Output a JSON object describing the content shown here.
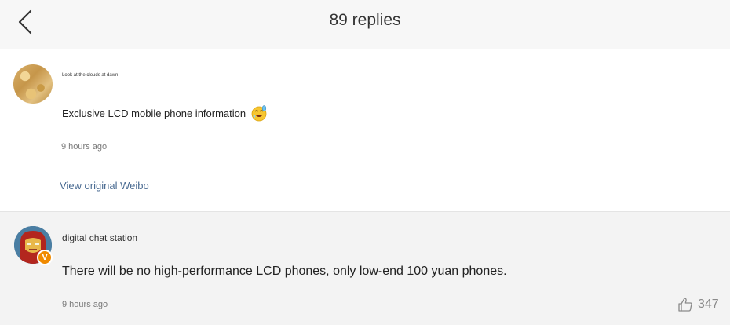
{
  "header": {
    "title": "89 replies",
    "back_icon": "chevron-left-icon"
  },
  "original_post": {
    "username": "Look at the clouds at dawn",
    "text": "Exclusive LCD mobile phone information",
    "emoji": "sweating-laugh-emoji-icon",
    "time": "9 hours ago",
    "view_link": "View original Weibo"
  },
  "reply": {
    "username": "digital chat station",
    "verified_badge": "V",
    "text": "There will be no high-performance LCD phones, only low-end 100 yuan phones.",
    "time": "9 hours ago",
    "likes": "347",
    "like_icon": "thumbs-up-icon"
  },
  "colors": {
    "link": "#4a6b92",
    "badge": "#f08a00",
    "background": "#f3f3f3"
  }
}
